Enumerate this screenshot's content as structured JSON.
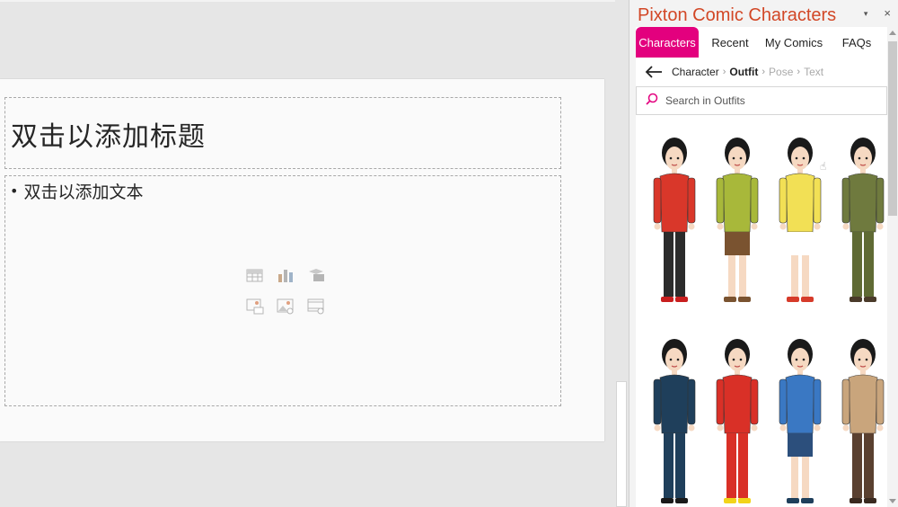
{
  "slide": {
    "title_placeholder": "双击以添加标题",
    "body_placeholder": "双击以添加文本",
    "insert_icons": [
      "table-icon",
      "chart-icon",
      "smartart-icon",
      "online-picture-icon",
      "picture-icon",
      "video-icon"
    ]
  },
  "pane": {
    "title": "Pixton Comic Characters",
    "menu_caret": "▾",
    "close_glyph": "×"
  },
  "tabs": [
    {
      "label": "Characters",
      "active": true
    },
    {
      "label": "Recent",
      "active": false
    },
    {
      "label": "My Comics",
      "active": false
    },
    {
      "label": "FAQs",
      "active": false
    }
  ],
  "breadcrumb": {
    "step1": "Character",
    "step2": "Outfit",
    "step3": "Pose",
    "step4": "Text",
    "separator": "›"
  },
  "search": {
    "placeholder": "Search in Outfits"
  },
  "outfits": [
    {
      "name": "red-blouse-outfit",
      "top": "#d9372a",
      "bottom": "#2b2b2b",
      "shoes": "#c81e1e",
      "pants": true
    },
    {
      "name": "green-shirt-outfit",
      "top": "#a8b83a",
      "bottom": "#7a5330",
      "shoes": "#7a5330",
      "pants": false
    },
    {
      "name": "yellow-tee-outfit",
      "top": "#f2e055",
      "bottom": "#ffffff",
      "shoes": "#d63b2a",
      "pants": false
    },
    {
      "name": "olive-cargo-outfit",
      "top": "#6f7a3e",
      "bottom": "#5f6a34",
      "shoes": "#4a3a2a",
      "pants": true
    },
    {
      "name": "police-uniform-outfit",
      "top": "#1f3f5b",
      "bottom": "#1f3f5b",
      "shoes": "#1a1a1a",
      "pants": true
    },
    {
      "name": "red-superhero-outfit",
      "top": "#d93027",
      "bottom": "#d93027",
      "shoes": "#f2d41a",
      "pants": true
    },
    {
      "name": "blue-superhero-outfit",
      "top": "#3a78c3",
      "bottom": "#2c4f7c",
      "shoes": "#1f3f5b",
      "pants": false
    },
    {
      "name": "tan-casual-outfit",
      "top": "#c9a57c",
      "bottom": "#5a4030",
      "shoes": "#3a2a20",
      "pants": true
    }
  ],
  "colors": {
    "accent_tab": "#e3007e",
    "pane_title": "#d24726"
  }
}
